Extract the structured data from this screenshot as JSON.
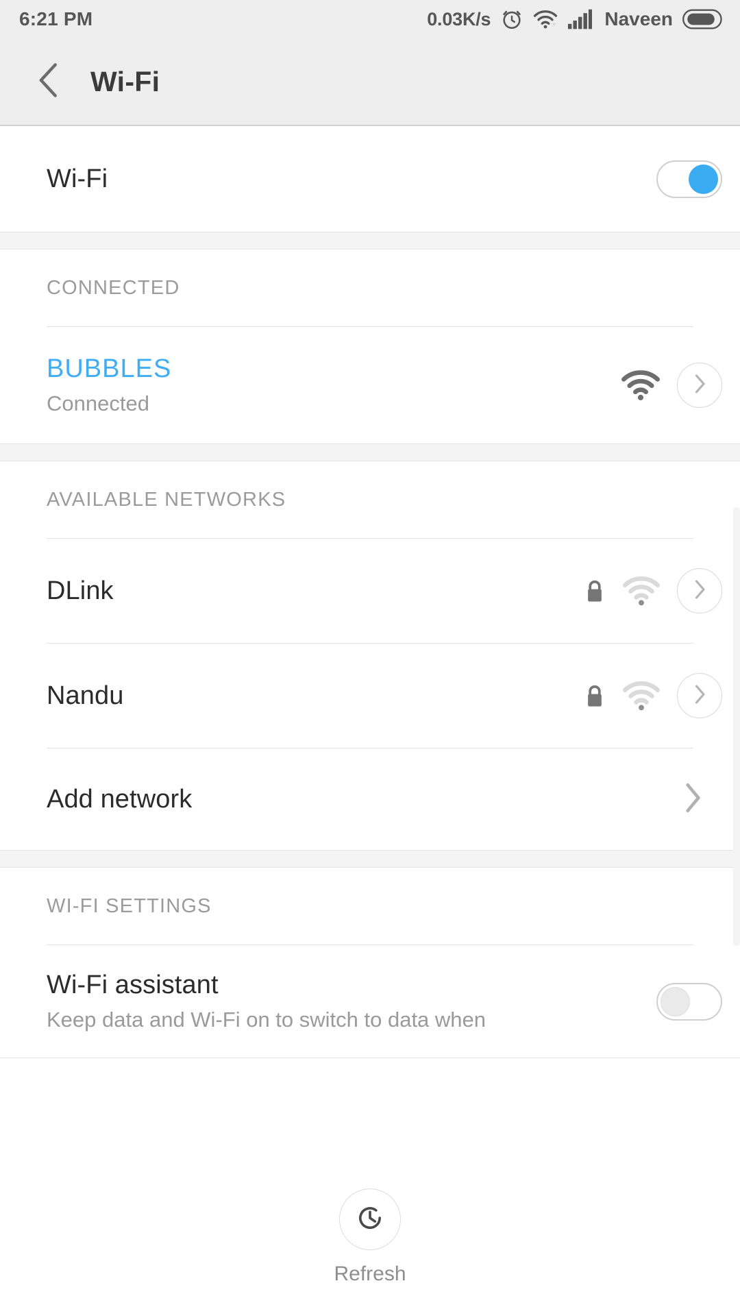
{
  "statusbar": {
    "time": "6:21 PM",
    "network_speed": "0.03K/s",
    "carrier": "Naveen",
    "icons": [
      "alarm-clock-icon",
      "wifi-icon",
      "cellular-signal-icon",
      "battery-icon"
    ]
  },
  "titlebar": {
    "back_label": "back-chevron-icon",
    "title": "Wi-Fi"
  },
  "wifi_toggle_row": {
    "label": "Wi-Fi",
    "state": "on"
  },
  "connected_section": {
    "header": "CONNECTED",
    "network": {
      "ssid": "BUBBLES",
      "status": "Connected",
      "signal": "strong",
      "secured": false
    }
  },
  "available_section": {
    "header": "AVAILABLE NETWORKS",
    "networks": [
      {
        "ssid": "DLink",
        "secured": true,
        "signal": "weak"
      },
      {
        "ssid": "Nandu",
        "secured": true,
        "signal": "weak"
      }
    ],
    "add_network_label": "Add network"
  },
  "settings_section": {
    "header": "WI-FI SETTINGS",
    "assistant": {
      "title": "Wi-Fi assistant",
      "subtitle": "Keep data and Wi-Fi on to switch to data when",
      "state": "off"
    }
  },
  "footer": {
    "refresh_label": "Refresh"
  },
  "colors": {
    "accent_blue": "#3fadf3",
    "toggle_on": "#3bacf2",
    "header_bg": "#eeeeee",
    "section_bg": "#f4f4f4",
    "muted_text": "#9b9b9b"
  }
}
